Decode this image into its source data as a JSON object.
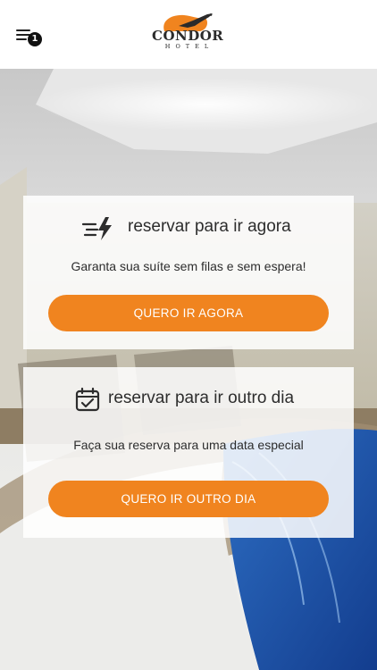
{
  "header": {
    "menu_icon": "hamburger-menu-icon",
    "menu_badge": "1",
    "logo_name": "CONDOR",
    "logo_sub": "HOTEL"
  },
  "cards": [
    {
      "icon": "lightning-icon",
      "title": "reservar para ir agora",
      "subtitle": "Garanta sua suíte sem filas e sem espera!",
      "button": "QUERO IR AGORA"
    },
    {
      "icon": "calendar-check-icon",
      "title": "reservar para ir outro dia",
      "subtitle": "Faça sua reserva para uma data especial",
      "button": "QUERO IR OUTRO DIA"
    }
  ],
  "colors": {
    "accent": "#f0841f",
    "header_bg": "#ffffff",
    "card_bg": "#ffffff"
  }
}
